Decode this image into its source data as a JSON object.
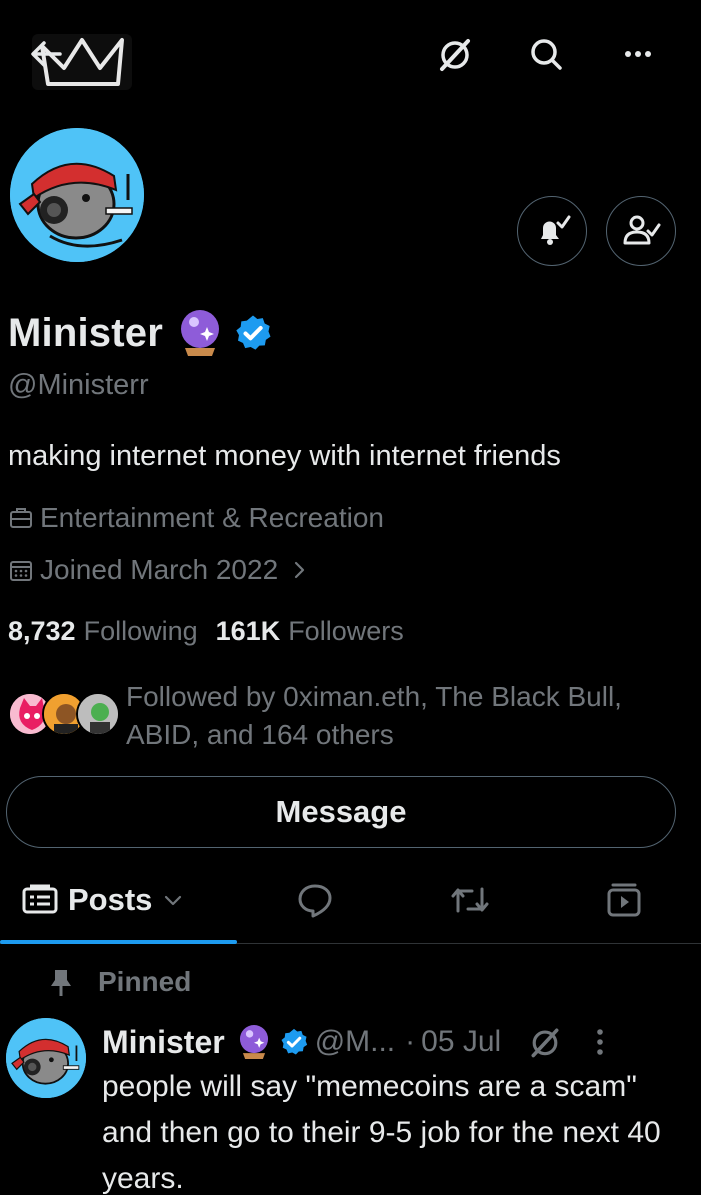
{
  "header": {
    "back_icon": "back-arrow-icon",
    "logo_icon": "crown-icon",
    "actions": [
      "grok-icon",
      "search-icon",
      "more-icon"
    ]
  },
  "profile": {
    "name": "Minister",
    "handle": "@Ministerr",
    "bio": "making internet money with internet friends",
    "category": "Entertainment & Recreation",
    "joined": "Joined March 2022",
    "following_count": "8,732",
    "following_label": "Following",
    "followers_count": "161K",
    "followers_label": "Followers",
    "followed_by": "Followed by 0ximan.eth, The Black Bull, ABID, and 164 others",
    "message_label": "Message",
    "verified_color": "#1d9bf0"
  },
  "tabs": {
    "posts_label": "Posts"
  },
  "pinned_post": {
    "pinned_label": "Pinned",
    "author": "Minister",
    "handle": "@M...",
    "separator": "·",
    "date": "05 Jul",
    "text": "people will say \"memecoins are a scam\" and then go to their 9-5 job for the next 40 years."
  },
  "colors": {
    "background": "#000000",
    "text_primary": "#e7e9ea",
    "text_secondary": "#71767b",
    "accent": "#1d9bf0",
    "border": "#536471"
  }
}
